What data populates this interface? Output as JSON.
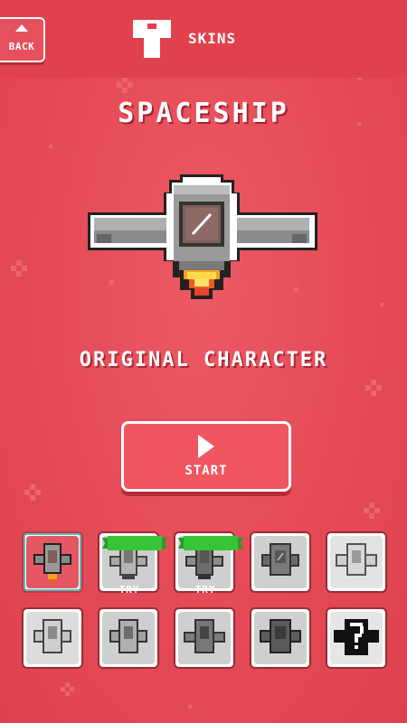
{
  "header": {
    "back_label": "BACK",
    "section_label": "SKINS"
  },
  "title": "SPACESHIP",
  "subtitle": "ORIGINAL CHARACTER",
  "start_label": "START",
  "try_label": "TRY",
  "colors": {
    "background": "#e44a56",
    "accent_green": "#39c437",
    "selected_border": "#4cc0c0"
  },
  "skins": [
    {
      "name": "skin-original",
      "state": "selected"
    },
    {
      "name": "skin-2",
      "state": "try"
    },
    {
      "name": "skin-3",
      "state": "try"
    },
    {
      "name": "skin-4",
      "state": "locked"
    },
    {
      "name": "skin-5",
      "state": "locked"
    },
    {
      "name": "skin-6",
      "state": "locked"
    },
    {
      "name": "skin-7",
      "state": "locked"
    },
    {
      "name": "skin-8",
      "state": "locked"
    },
    {
      "name": "skin-9",
      "state": "locked"
    },
    {
      "name": "skin-mystery",
      "state": "mystery"
    }
  ]
}
